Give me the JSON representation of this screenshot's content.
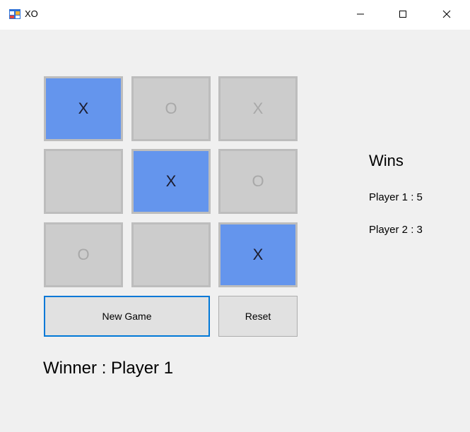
{
  "window": {
    "title": "XO"
  },
  "board": {
    "cells": [
      {
        "mark": "X",
        "highlight": true
      },
      {
        "mark": "O",
        "highlight": false
      },
      {
        "mark": "X",
        "highlight": false
      },
      {
        "mark": "",
        "highlight": false
      },
      {
        "mark": "X",
        "highlight": true
      },
      {
        "mark": "O",
        "highlight": false
      },
      {
        "mark": "O",
        "highlight": false
      },
      {
        "mark": "",
        "highlight": false
      },
      {
        "mark": "X",
        "highlight": true
      }
    ]
  },
  "buttons": {
    "new_game": "New Game",
    "reset": "Reset"
  },
  "status": {
    "winner": "Winner : Player 1"
  },
  "scores": {
    "title": "Wins",
    "player1": "Player 1 : 5",
    "player2": "Player 2 : 3"
  },
  "colors": {
    "highlight": "#6495ed",
    "cell": "#cccccc",
    "focus": "#0078d7"
  }
}
